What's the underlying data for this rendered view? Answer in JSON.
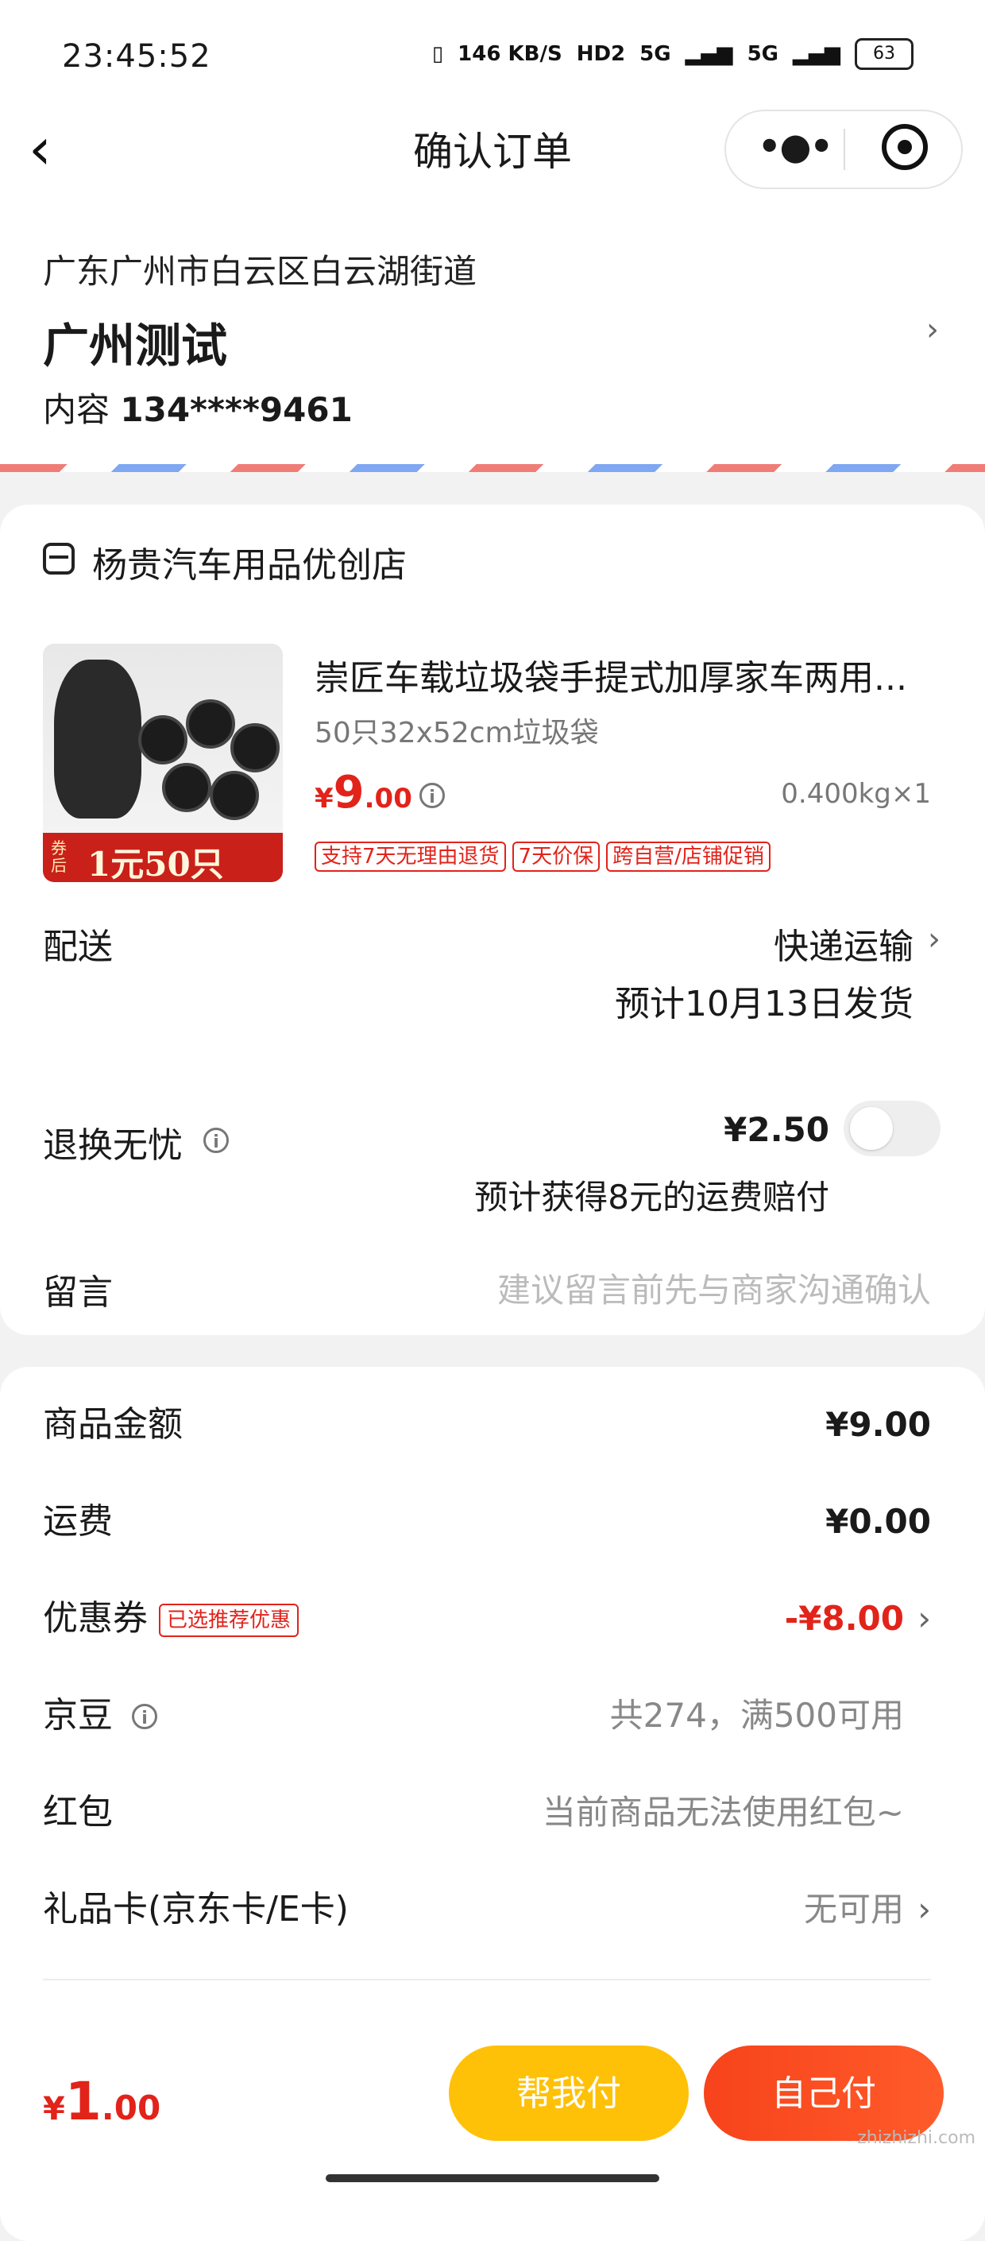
{
  "status_bar": {
    "time": "23:45:52",
    "net_speed": "146 KB/S",
    "hd": "HD2",
    "signal1": "5G",
    "signal2": "5G",
    "battery": "63"
  },
  "nav": {
    "title": "确认订单"
  },
  "address": {
    "line": "广东广州市白云区白云湖街道",
    "name": "广州测试",
    "phone_label": "内容",
    "phone": "134****9461"
  },
  "shop": {
    "name": "杨贵汽车用品优创店",
    "product": {
      "title": "崇匠车载垃圾袋手提式加厚家车两用...",
      "spec": "50只32x52cm垃圾袋",
      "price_currency": "¥",
      "price_int": "9",
      "price_dec": ".00",
      "weight": "0.400kg×1",
      "promo_tag": "券后",
      "promo_text": "1元50只",
      "tags": [
        "支持7天无理由退货",
        "7天价保",
        "跨自营/店铺促销"
      ]
    },
    "delivery": {
      "label": "配送",
      "method": "快递运输",
      "date": "预计10月13日发货"
    },
    "returns": {
      "label": "退换无忧",
      "price": "¥2.50",
      "note": "预计获得8元的运费赔付"
    },
    "message": {
      "label": "留言",
      "placeholder": "建议留言前先与商家沟通确认"
    }
  },
  "summary": {
    "goods_label": "商品金额",
    "goods_value": "¥9.00",
    "freight_label": "运费",
    "freight_value": "¥0.00",
    "coupon_label": "优惠券",
    "coupon_tag": "已选推荐优惠",
    "coupon_value": "-¥8.00",
    "beans_label": "京豆",
    "beans_value": "共274，满500可用",
    "redpack_label": "红包",
    "redpack_value": "当前商品无法使用红包~",
    "giftcard_label": "礼品卡(京东卡/E卡)",
    "giftcard_value": "无可用"
  },
  "bottom": {
    "total_currency": "¥",
    "total_int": "1",
    "total_dec": ".00",
    "help_pay": "帮我付",
    "self_pay": "自己付",
    "watermark": "zhizhizhi.com"
  },
  "colors": {
    "accent": "#e2231a",
    "help_button": "#ffc107",
    "pay_button": "#f7431b"
  }
}
